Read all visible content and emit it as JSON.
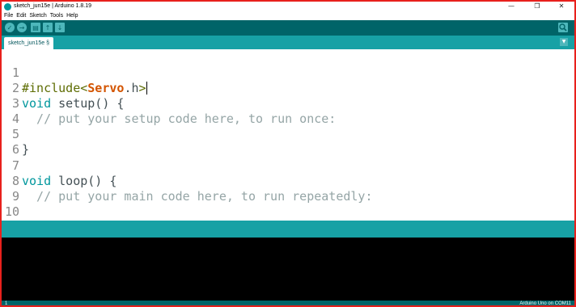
{
  "window": {
    "title": "sketch_jun15e | Arduino 1.8.19",
    "minimize_glyph": "—",
    "maximize_glyph": "❐",
    "close_glyph": "✕"
  },
  "menu": [
    "File",
    "Edit",
    "Sketch",
    "Tools",
    "Help"
  ],
  "toolbar": {
    "verify_icon": "check-icon",
    "upload_icon": "arrow-right-icon",
    "new_icon": "new-file-icon",
    "open_icon": "arrow-up-icon",
    "save_icon": "arrow-down-icon",
    "serial_monitor_icon": "magnifier-icon",
    "verify_glyph": "✓",
    "upload_glyph": "→",
    "new_glyph": "▤",
    "open_glyph": "↑",
    "save_glyph": "↓"
  },
  "tabs": {
    "active_tab": "sketch_jun15e §",
    "menu_glyph": "▼"
  },
  "editor": {
    "line_numbers": [
      "1",
      "2",
      "3",
      "4",
      "5",
      "6",
      "7",
      "8",
      "9",
      "10"
    ],
    "line1": {
      "directive": "#include",
      "lt": "<",
      "lib": "Servo",
      "ext": ".h",
      "gt": ">"
    },
    "line2": {
      "kw": "void",
      "rest": " setup() {"
    },
    "line3": {
      "comment": "  // put your setup code here, to run once:"
    },
    "line5": {
      "text": "}"
    },
    "line7": {
      "kw": "void",
      "rest": " loop() {"
    },
    "line8": {
      "comment": "  // put your main code here, to run repeatedly:"
    },
    "line10": {
      "text": "}"
    }
  },
  "statusbar": {
    "line_indicator": "1",
    "board_port": "Arduino Uno on COM11"
  },
  "colors": {
    "teal_dark": "#006468",
    "teal": "#17a1a5",
    "keyword": "#00979d",
    "comment": "#95a5a6",
    "frame_red": "#e8201c"
  }
}
